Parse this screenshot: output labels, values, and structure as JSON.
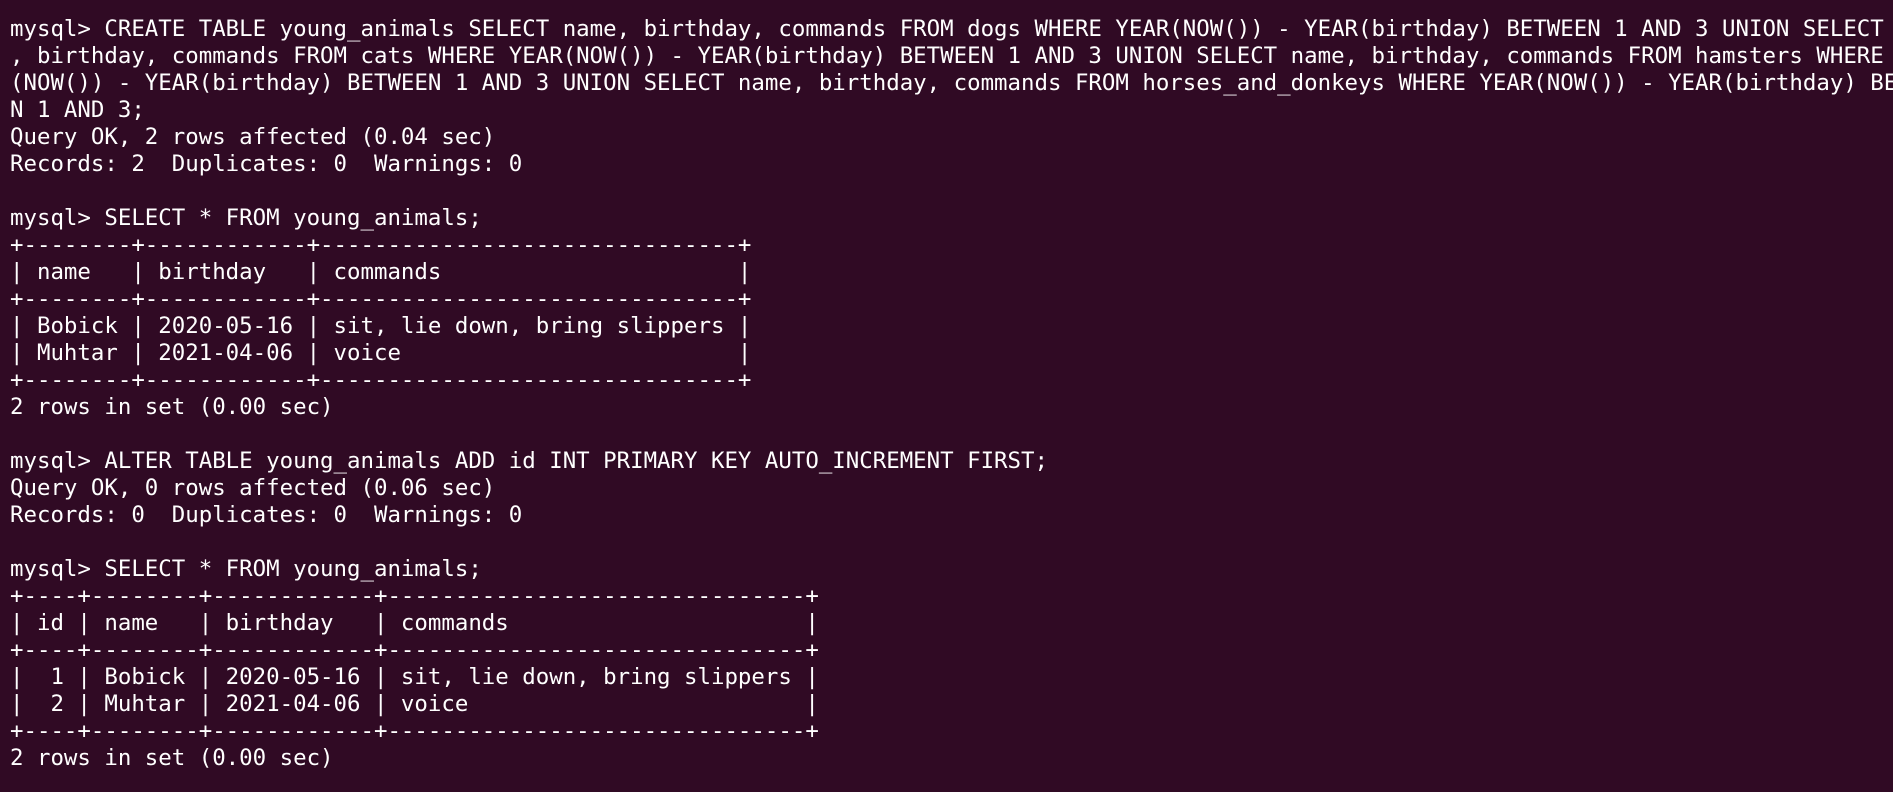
{
  "terminal": {
    "lines": [
      "mysql> CREATE TABLE young_animals SELECT name, birthday, commands FROM dogs WHERE YEAR(NOW()) - YEAR(birthday) BETWEEN 1 AND 3 UNION SELECT name",
      ", birthday, commands FROM cats WHERE YEAR(NOW()) - YEAR(birthday) BETWEEN 1 AND 3 UNION SELECT name, birthday, commands FROM hamsters WHERE YEAR",
      "(NOW()) - YEAR(birthday) BETWEEN 1 AND 3 UNION SELECT name, birthday, commands FROM horses_and_donkeys WHERE YEAR(NOW()) - YEAR(birthday) BETWEE",
      "N 1 AND 3;",
      "Query OK, 2 rows affected (0.04 sec)",
      "Records: 2  Duplicates: 0  Warnings: 0",
      "",
      "mysql> SELECT * FROM young_animals;",
      "+--------+------------+-------------------------------+",
      "| name   | birthday   | commands                      |",
      "+--------+------------+-------------------------------+",
      "| Bobick | 2020-05-16 | sit, lie down, bring slippers |",
      "| Muhtar | 2021-04-06 | voice                         |",
      "+--------+------------+-------------------------------+",
      "2 rows in set (0.00 sec)",
      "",
      "mysql> ALTER TABLE young_animals ADD id INT PRIMARY KEY AUTO_INCREMENT FIRST;",
      "Query OK, 0 rows affected (0.06 sec)",
      "Records: 0  Duplicates: 0  Warnings: 0",
      "",
      "mysql> SELECT * FROM young_animals;",
      "+----+--------+------------+-------------------------------+",
      "| id | name   | birthday   | commands                      |",
      "+----+--------+------------+-------------------------------+",
      "|  1 | Bobick | 2020-05-16 | sit, lie down, bring slippers |",
      "|  2 | Muhtar | 2021-04-06 | voice                         |",
      "+----+--------+------------+-------------------------------+",
      "2 rows in set (0.00 sec)"
    ]
  }
}
